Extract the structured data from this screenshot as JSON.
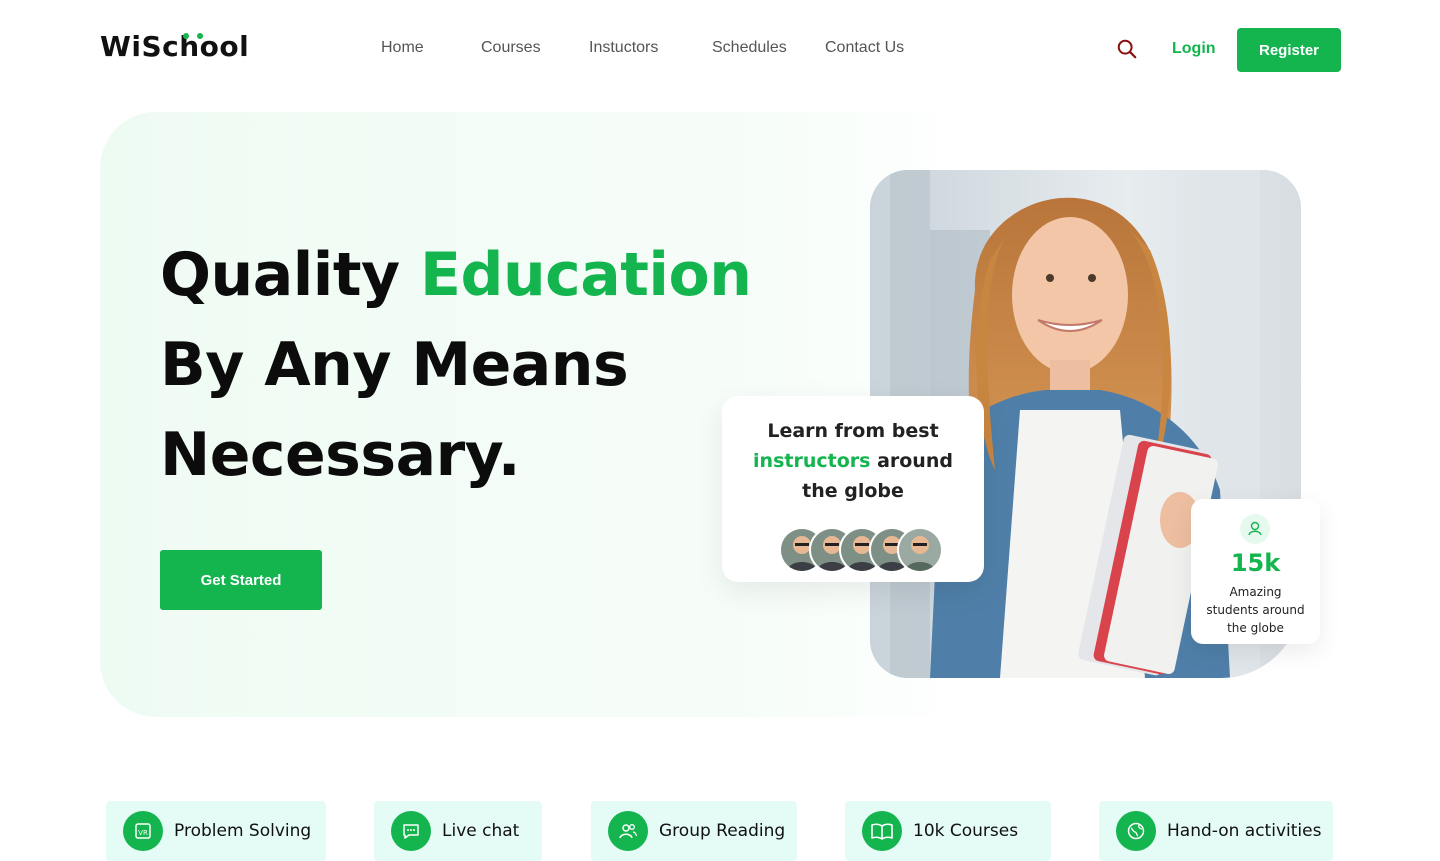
{
  "header": {
    "logo": "WiSchool",
    "nav": [
      "Home",
      "Courses",
      "Instuctors",
      "Schedules",
      "Contact Us"
    ],
    "search_icon": "search-icon",
    "login_label": "Login",
    "register_label": "Register"
  },
  "hero": {
    "line1_part1": "Quality",
    "line1_part2": "Education",
    "line2": "By Any Means",
    "line3": "Necessary.",
    "cta_label": "Get Started"
  },
  "instructor_card": {
    "text_part1": "Learn from best",
    "text_accent": "instructors",
    "text_part2": "around",
    "text_part3": "the globe",
    "avatar_count": 5
  },
  "stat_card": {
    "icon": "user-icon",
    "value": "15k",
    "label_line1": "Amazing",
    "label_line2": "students around",
    "label_line3": "the globe"
  },
  "features": [
    {
      "label": "Problem Solving",
      "icon": "vr-icon"
    },
    {
      "label": "Live chat",
      "icon": "chat-icon"
    },
    {
      "label": "Group Reading",
      "icon": "users-icon"
    },
    {
      "label": "10k Courses",
      "icon": "book-icon"
    },
    {
      "label": "Hand-on activities",
      "icon": "globe-icon"
    }
  ],
  "colors": {
    "accent": "#14b44f",
    "hero_bg": "#eefbf3",
    "feature_bg": "#e4fbf6",
    "search_icon": "#8b1010"
  }
}
